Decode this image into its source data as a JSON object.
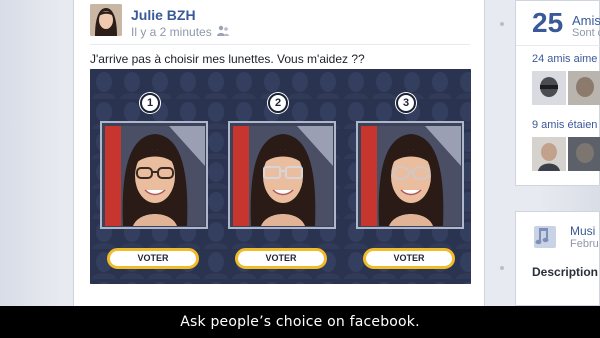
{
  "post": {
    "author": "Julie BZH",
    "timestamp": "Il y a 2 minutes",
    "text": "J'arrive pas à choisir mes lunettes. Vous m'aidez ??"
  },
  "poll": {
    "options": [
      {
        "number": "1",
        "vote_label": "VOTER"
      },
      {
        "number": "2",
        "vote_label": "VOTER"
      },
      {
        "number": "3",
        "vote_label": "VOTER"
      }
    ]
  },
  "sidebar": {
    "friends_count": "25",
    "friends_label": "Amis",
    "friends_sub": "Sont c",
    "line1": "24 amis aime",
    "line2": "9 amis étaien",
    "music_label": "Musi",
    "music_sub": "Febru",
    "description_label": "Description"
  },
  "caption": "Ask people’s choice on facebook.",
  "colors": {
    "facebook_blue": "#3b5998",
    "vote_button_border": "#f0bd2a",
    "poll_background": "#2a3350"
  }
}
